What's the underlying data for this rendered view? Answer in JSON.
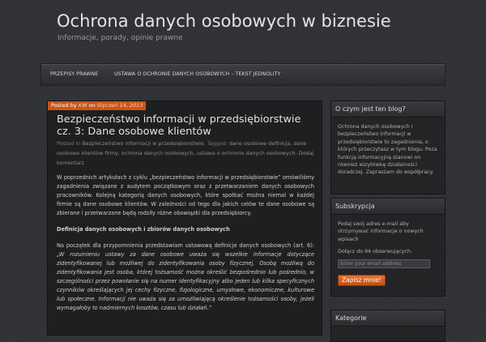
{
  "header": {
    "title": "Ochrona danych osobowych w biznesie",
    "description": "Informacje, porady, opinie prawne"
  },
  "nav": {
    "items": [
      "PRZEPISY PRAWNE",
      "USTAWA O OCHRONIE DANYCH OSOBOWYCH – TEKST JEDNOLITY"
    ]
  },
  "post": {
    "posted_prefix": "Posted by ",
    "author": "KW",
    "on_text": " on ",
    "date": "Styczeń 14, 2013",
    "title": "Bezpieczeństwo informacji w przedsiębiorstwie cz. 3: Dane osobowe klientów",
    "meta_prefix": "Posted in ",
    "category": "Bezpieczeństwo informacji w przedsiębiorstwie",
    "tagged_text": ". Tagged: ",
    "tags": "dane osobowe definicja, dane osobowe klientów firmy, ochrona danych osobowych, ustawa o ochronie danych osobowych",
    "comment_link": ". Dodaj komentarz",
    "paragraph1": "W poprzednich artykułach z cyklu „bezpieczeństwo informacji w przedsiębiorstwie” omówiliśmy zagadnienia związane z audytem początkowym oraz z przetwarzaniem danych osobowych pracowników. Kolejną kategorią danych osobowych, które spotkać można niemal w każdej firmie są dane osobowe klientów. W zależności od tego dla jakich celów te dane osobowe są zbierane i przetwarzane będą rodziły różne obowiązki dla przedsiębiorcy.",
    "subheading": "Definicja danych osobowych i zbiorów danych osobowych",
    "paragraph2": "Na początek dla przypomnienia przedstawiam ustawową definicje danych osobowych (art. 6):",
    "quote": "„W rozumieniu ustawy za dane osobowe uważa się wszelkie informacje dotyczące zidentyfikowanej lub możliwej do zidentyfikowania osoby fizycznej.  Osobą możliwą do zidentyfikowania jest osoba, której tożsamość można określić bezpośrednio lub pośrednio, w szczególności przez powołanie się na numer identyfikacyjny albo jeden lub kilka specyficznych czynników określających jej cechy fizyczne, fizjologiczne, umysłowe, ekonomiczne, kulturowe lub społeczne. Informacji nie uważa się za umożliwiającą określenie tożsamości osoby, jeżeli wymagałoby to nadmiernych kosztów, czasu lub działań.”"
  },
  "sidebar": {
    "about": {
      "title": "O czym jest ten blog?",
      "text": "Ochrona danych osobowych i bezpieczeństwo informacji w przedsiębiorstwie to zagadnienia, o których przeczytasz w tym blogu. Poza funkcją informacyjną stanowi on również wizytówkę działalności doradczej. Zapraszam do współpracy."
    },
    "subscribe": {
      "title": "Subskrypcja",
      "text": "Podaj swój adres e-mail aby otrzymywać informacje o nowych wpisach",
      "join_text": "Dołącz do 94 obserwujących.",
      "email_placeholder": "Enter your email address",
      "button_label": "Zapisz mnie!"
    },
    "categories": {
      "title": "Kategorie"
    }
  }
}
